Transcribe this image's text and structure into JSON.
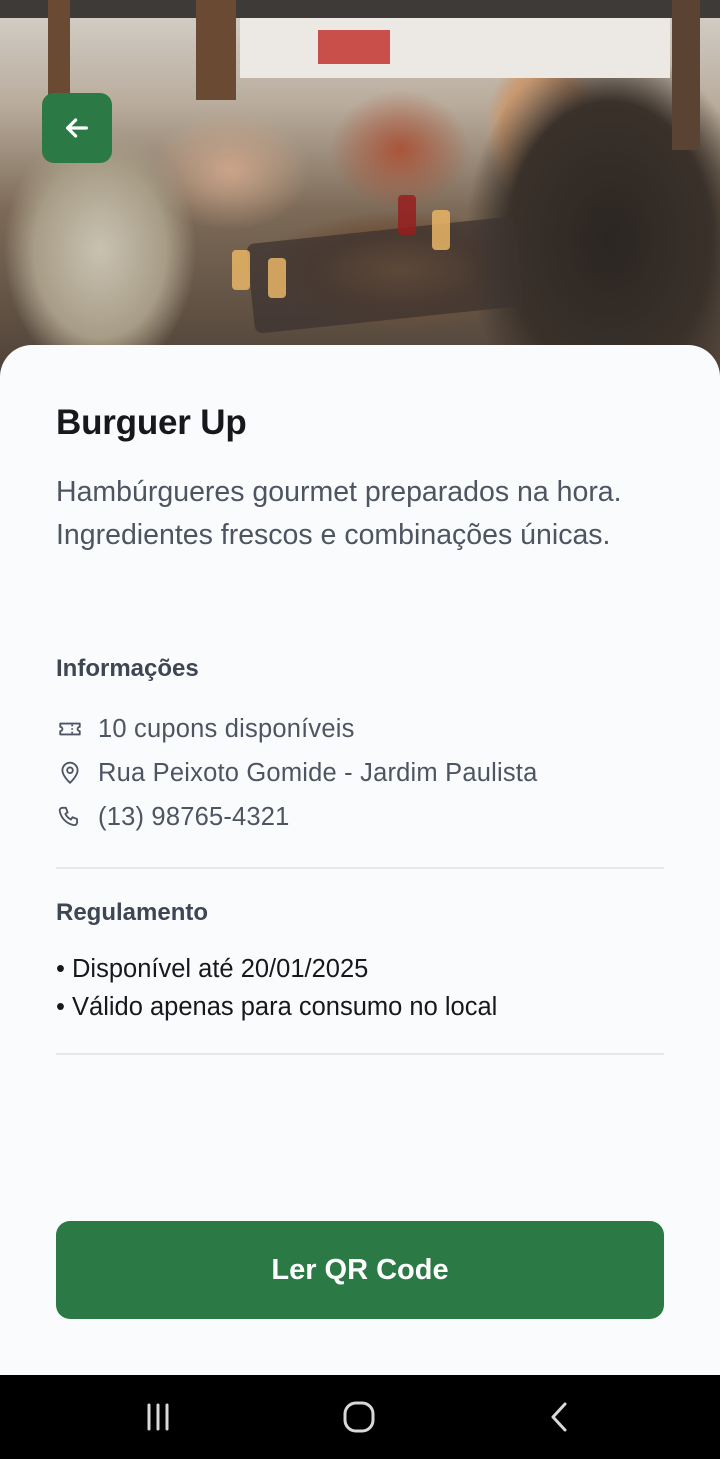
{
  "header": {
    "back_button": {
      "icon": "arrow-left-icon",
      "color": "#2B7A45"
    }
  },
  "hero": {
    "image": "restaurant-people-dining-photo"
  },
  "restaurant": {
    "name": "Burguer Up",
    "description": "Hambúrgueres gourmet preparados na hora. Ingredientes frescos e combinações únicas."
  },
  "info": {
    "heading": "Informações",
    "items": [
      {
        "icon": "ticket-icon",
        "text": "10 cupons disponíveis"
      },
      {
        "icon": "map-pin-icon",
        "text": "Rua Peixoto Gomide - Jardim Paulista"
      },
      {
        "icon": "phone-icon",
        "text": "(13) 98765-4321"
      }
    ]
  },
  "rules": {
    "heading": "Regulamento",
    "items": [
      "• Disponível até 20/01/2025",
      "• Válido apenas para consumo no local"
    ]
  },
  "cta": {
    "label": "Ler QR Code",
    "color": "#2B7A45"
  },
  "system_nav": {
    "buttons": [
      "recent-apps-icon",
      "home-icon",
      "back-icon"
    ]
  }
}
